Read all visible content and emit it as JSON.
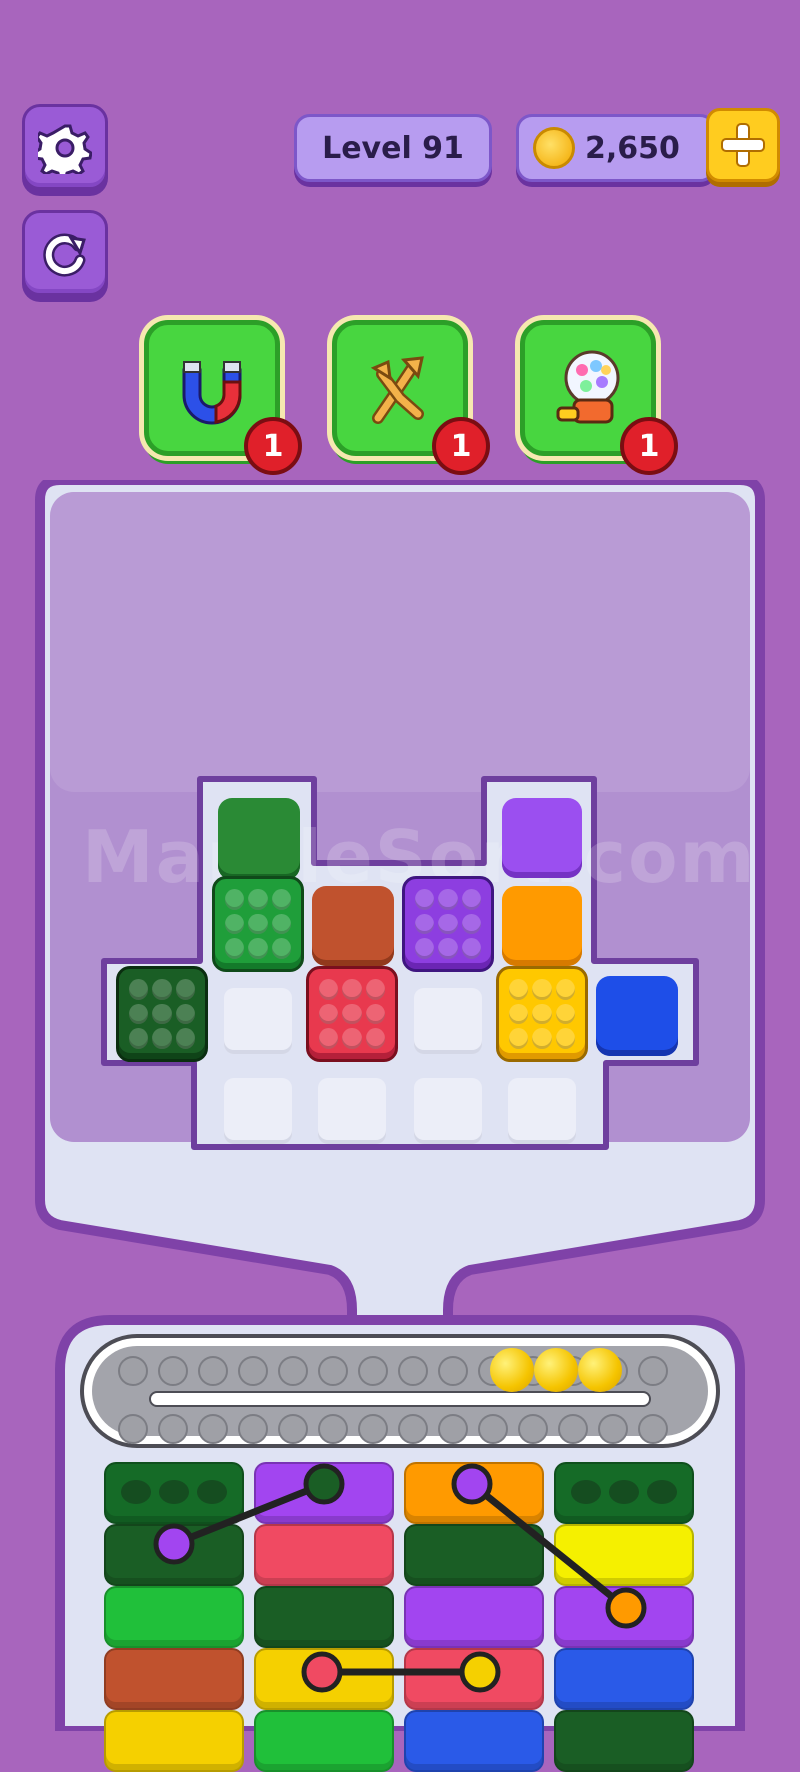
{
  "hud": {
    "level_label": "Level 91",
    "coins": "2,650"
  },
  "boosters": [
    {
      "name": "magnet",
      "count": "1"
    },
    {
      "name": "shuffle",
      "count": "1"
    },
    {
      "name": "gumball",
      "count": "1"
    }
  ],
  "watermark": "MarbleSort.com",
  "board": {
    "blocks": [
      {
        "color": "#2a8a35"
      },
      {
        "color": "#1f9e3a"
      },
      {
        "color": "#c0522e"
      },
      {
        "color": "#8d3ee0"
      },
      {
        "color": "#1a5e25"
      },
      {
        "color": "#e8394e"
      },
      {
        "color": "#ffc800"
      },
      {
        "color": "#9b4ff0"
      },
      {
        "color": "#ff9a00"
      },
      {
        "color": "#1e4ee8"
      }
    ]
  },
  "conveyor": {
    "balls": 3,
    "ball_color": "#f5c400"
  },
  "stacks": [
    {
      "layers": [
        "#156b27",
        "#1a5e25",
        "#20c03a",
        "#c0522e",
        "#f5d000"
      ]
    },
    {
      "layers": [
        "#a245f0",
        "#f04a62",
        "#1a5e25",
        "#f5d000",
        "#20c03a"
      ]
    },
    {
      "layers": [
        "#ff9a00",
        "#1a5e25",
        "#a245f0",
        "#f04a62",
        "#2a5ae8"
      ]
    },
    {
      "layers": [
        "#156b27",
        "#f5f000",
        "#a245f0",
        "#2a5ae8",
        "#1a5e25"
      ]
    }
  ],
  "ropes_color": "#222222"
}
